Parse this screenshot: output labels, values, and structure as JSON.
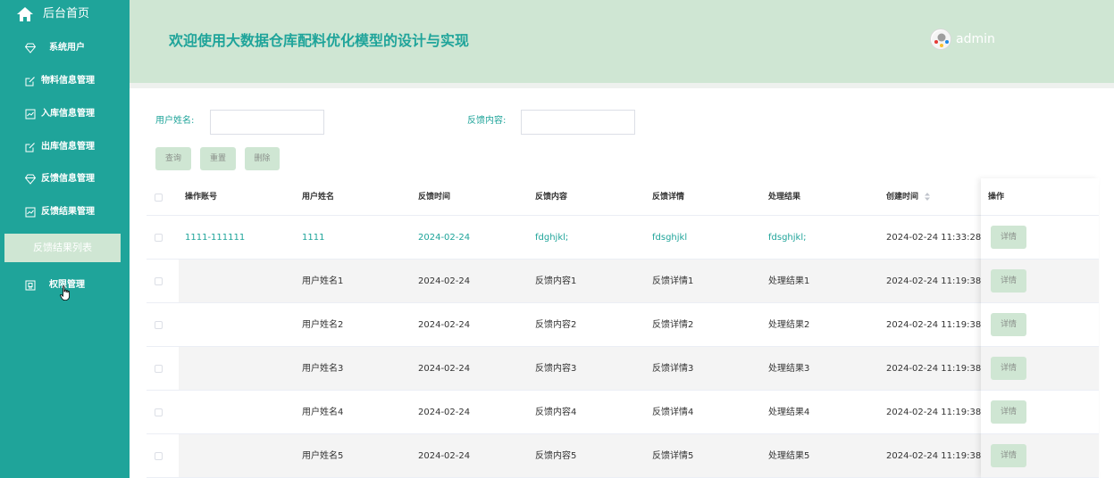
{
  "sidebar": {
    "home_label": "后台首页",
    "items": [
      {
        "label": "系统用户",
        "icon": "diamond-icon"
      },
      {
        "label": "物料信息管理",
        "icon": "edit-icon"
      },
      {
        "label": "入库信息管理",
        "icon": "chart-icon"
      },
      {
        "label": "出库信息管理",
        "icon": "edit-icon"
      },
      {
        "label": "反馈信息管理",
        "icon": "diamond-icon"
      },
      {
        "label": "反馈结果管理",
        "icon": "chart-icon"
      },
      {
        "label": "权限管理",
        "icon": "key-icon"
      }
    ],
    "active_sub": "反馈结果列表"
  },
  "header": {
    "title": "欢迎使用大数据仓库配料优化模型的设计与实现",
    "username": "admin"
  },
  "search": {
    "username_label": "用户姓名:",
    "content_label": "反馈内容:",
    "username_value": "",
    "content_value": "",
    "query_label": "查询",
    "reset_label": "重置",
    "delete_label": "删除"
  },
  "table": {
    "headers": {
      "account": "操作账号",
      "name": "用户姓名",
      "time": "反馈时间",
      "content": "反馈内容",
      "detail": "反馈详情",
      "result": "处理结果",
      "created": "创建时间",
      "ops": "操作"
    },
    "detail_label": "详情",
    "rows": [
      {
        "account": "1111-111111",
        "name": "1111",
        "time": "2024-02-24",
        "content": "fdghjkl;",
        "detail": "fdsghjkl",
        "result": "fdsghjkl;",
        "created": "2024-02-24 11:33:28"
      },
      {
        "account": "",
        "name": "用户姓名1",
        "time": "2024-02-24",
        "content": "反馈内容1",
        "detail": "反馈详情1",
        "result": "处理结果1",
        "created": "2024-02-24 11:19:38"
      },
      {
        "account": "",
        "name": "用户姓名2",
        "time": "2024-02-24",
        "content": "反馈内容2",
        "detail": "反馈详情2",
        "result": "处理结果2",
        "created": "2024-02-24 11:19:38"
      },
      {
        "account": "",
        "name": "用户姓名3",
        "time": "2024-02-24",
        "content": "反馈内容3",
        "detail": "反馈详情3",
        "result": "处理结果3",
        "created": "2024-02-24 11:19:38"
      },
      {
        "account": "",
        "name": "用户姓名4",
        "time": "2024-02-24",
        "content": "反馈内容4",
        "detail": "反馈详情4",
        "result": "处理结果4",
        "created": "2024-02-24 11:19:38"
      },
      {
        "account": "",
        "name": "用户姓名5",
        "time": "2024-02-24",
        "content": "反馈内容5",
        "detail": "反馈详情5",
        "result": "处理结果5",
        "created": "2024-02-24 11:19:38"
      }
    ]
  },
  "colors": {
    "accent": "#1fa49a",
    "header_bg": "#cfe6d3",
    "button_bg": "#cfe6d3"
  }
}
